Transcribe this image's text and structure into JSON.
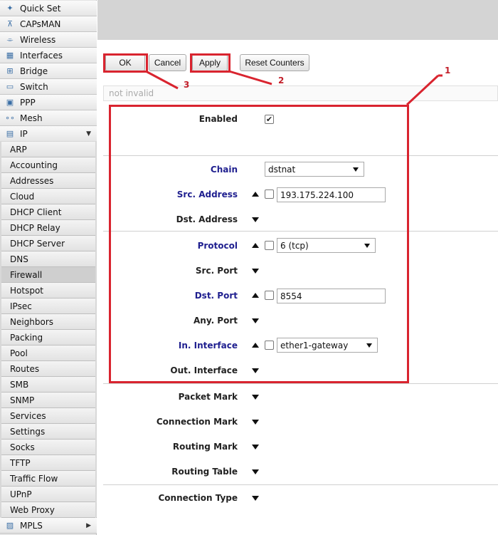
{
  "sidebar": {
    "top_items": [
      {
        "label": "Quick Set",
        "icon": "magic-wand-icon"
      },
      {
        "label": "CAPsMAN",
        "icon": "antenna-icon"
      },
      {
        "label": "Wireless",
        "icon": "wireless-icon"
      },
      {
        "label": "Interfaces",
        "icon": "interfaces-icon"
      },
      {
        "label": "Bridge",
        "icon": "bridge-icon"
      },
      {
        "label": "Switch",
        "icon": "switch-icon"
      },
      {
        "label": "PPP",
        "icon": "ppp-icon"
      },
      {
        "label": "Mesh",
        "icon": "mesh-icon"
      },
      {
        "label": "IP",
        "icon": "ip-icon"
      }
    ],
    "ip_submenu": [
      "ARP",
      "Accounting",
      "Addresses",
      "Cloud",
      "DHCP Client",
      "DHCP Relay",
      "DHCP Server",
      "DNS",
      "Firewall",
      "Hotspot",
      "IPsec",
      "Neighbors",
      "Packing",
      "Pool",
      "Routes",
      "SMB",
      "SNMP",
      "Services",
      "Settings",
      "Socks",
      "TFTP",
      "Traffic Flow",
      "UPnP",
      "Web Proxy"
    ],
    "active_submenu": "Firewall",
    "bottom_item": {
      "label": "MPLS",
      "icon": "mpls-icon"
    }
  },
  "toolbar": {
    "ok_label": "OK",
    "cancel_label": "Cancel",
    "apply_label": "Apply",
    "reset_label": "Reset Counters"
  },
  "status_text": "not invalid",
  "form": {
    "enabled_label": "Enabled",
    "enabled_checked": true,
    "chain_label": "Chain",
    "chain_value": "dstnat",
    "src_address_label": "Src. Address",
    "src_address_value": "193.175.224.100",
    "dst_address_label": "Dst. Address",
    "protocol_label": "Protocol",
    "protocol_value": "6 (tcp)",
    "src_port_label": "Src. Port",
    "dst_port_label": "Dst. Port",
    "dst_port_value": "8554",
    "any_port_label": "Any. Port",
    "in_interface_label": "In. Interface",
    "in_interface_value": "ether1-gateway",
    "out_interface_label": "Out. Interface",
    "packet_mark_label": "Packet Mark",
    "connection_mark_label": "Connection Mark",
    "routing_mark_label": "Routing Mark",
    "routing_table_label": "Routing Table",
    "connection_type_label": "Connection Type"
  },
  "annotations": {
    "n1": "1",
    "n2": "2",
    "n3": "3",
    "color": "#d9242f"
  }
}
